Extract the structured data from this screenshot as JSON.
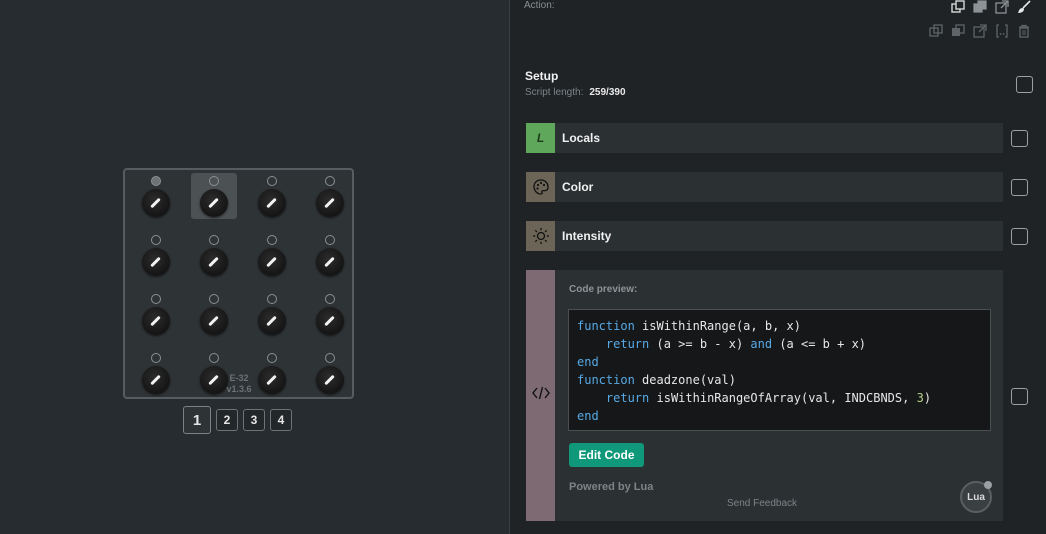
{
  "device": {
    "model": "E-32",
    "version": "v1.3.6",
    "selected_cell": 1,
    "lit_leds": [
      0
    ],
    "pages": [
      "1",
      "2",
      "3",
      "4"
    ],
    "active_page": 0
  },
  "panel": {
    "action_label": "Action:",
    "toolbar_icons": [
      "copy-icon",
      "paste-icon",
      "open-external-icon",
      "brush-icon",
      "duplicate-icon",
      "merge-icon",
      "export-icon",
      "bracket-icon",
      "trash-icon"
    ],
    "setup": {
      "title": "Setup",
      "script_length_label": "Script length:",
      "script_length_value": "259/390"
    },
    "blocks": [
      {
        "label": "Locals",
        "icon": "L",
        "icon_color": "#5fa85b"
      },
      {
        "label": "Color",
        "icon": "palette-icon",
        "icon_color": "#6b6457"
      },
      {
        "label": "Intensity",
        "icon": "sun-icon",
        "icon_color": "#6b6457"
      }
    ],
    "code": {
      "preview_label": "Code preview:",
      "strip_color": "#7d6a72",
      "lines": [
        "function isWithinRange(a, b, x)",
        "    return (a >= b - x) and (a <= b + x)",
        "end",
        "function deadzone(val)",
        "    return isWithinRangeOfArray(val, INDCBNDS, 3)",
        "end"
      ],
      "edit_button": "Edit Code",
      "powered_by": "Powered by Lua",
      "send_feedback": "Send Feedback",
      "logo_text": "Lua"
    }
  }
}
